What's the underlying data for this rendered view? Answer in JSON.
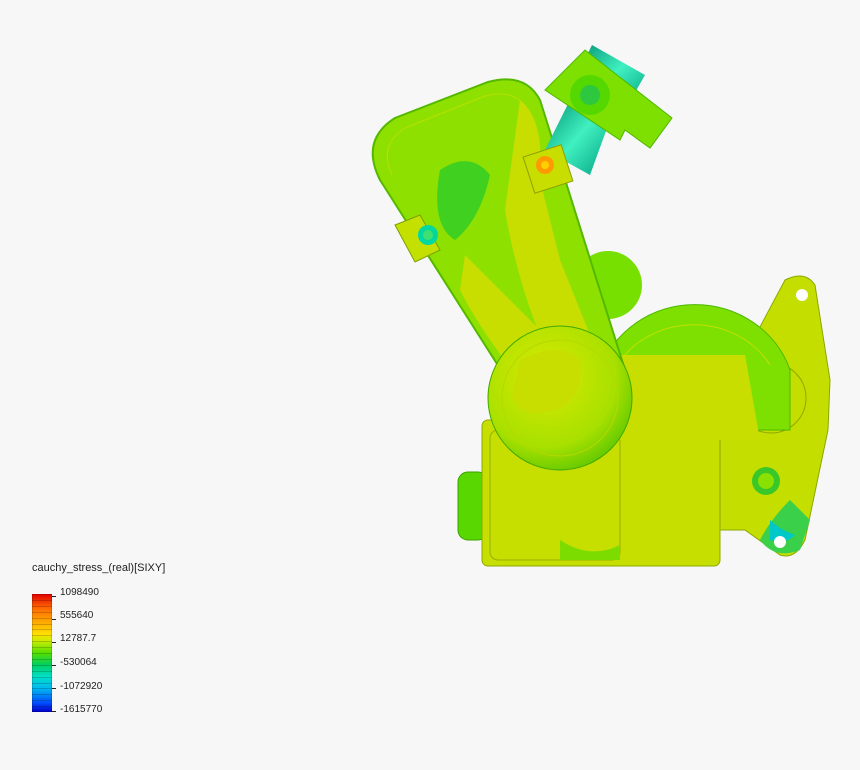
{
  "viewport": {
    "background": "#f7f7f7",
    "model_colors": {
      "base": "#c6e000",
      "green": "#6ee000",
      "cyan": "#00e0b0",
      "orange": "#ff7a00",
      "dark_green": "#22c822"
    }
  },
  "legend": {
    "title": "cauchy_stress_(real)[SIXY]",
    "labels": [
      "1098490",
      "555640",
      "12787.7",
      "-530064",
      "-1072920",
      "-1615770"
    ],
    "gradient": [
      "#e00000",
      "#ff6a00",
      "#ffa000",
      "#ffe000",
      "#c8ec00",
      "#55e000",
      "#00d060",
      "#00e0c8",
      "#00b8f0",
      "#0050ff",
      "#0000c8"
    ]
  }
}
